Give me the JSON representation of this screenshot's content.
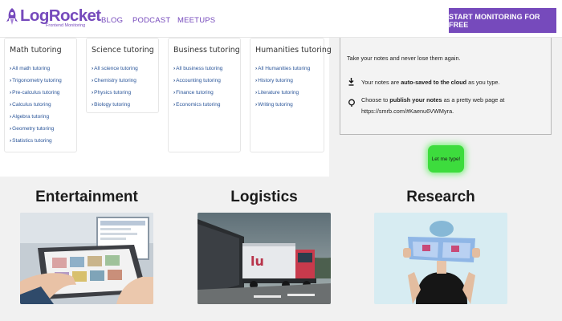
{
  "header": {
    "logo_text": "LogRocket",
    "logo_subtext": "Frontend Monitoring",
    "nav": [
      "BLOG",
      "PODCAST",
      "MEETUPS"
    ],
    "cta_label": "START MONITORING FOR FREE",
    "brand_color": "#764abc"
  },
  "tutoring": [
    {
      "title": "Math tutoring",
      "links": [
        "All math tutoring",
        "Trigonometry tutoring",
        "Pre-calculus tutoring",
        "Calculus tutoring",
        "Algebra tutoring",
        "Geometry tutoring",
        "Statistics tutoring"
      ]
    },
    {
      "title": "Science tutoring",
      "links": [
        "All science tutoring",
        "Chemistry tutoring",
        "Physics tutoring",
        "Biology tutoring"
      ]
    },
    {
      "title": "Business tutoring",
      "links": [
        "All business tutoring",
        "Accounting tutoring",
        "Finance tutoring",
        "Economics tutoring"
      ]
    },
    {
      "title": "Humanities tutoring",
      "links": [
        "All Humanities tutoring",
        "History tutoring",
        "Literature tutoring",
        "Writing tutoring"
      ]
    }
  ],
  "notes": {
    "intro": "Take your notes and never lose them again.",
    "line1_pre": "Your notes are ",
    "line1_bold": "auto-saved to the cloud",
    "line1_post": " as you type.",
    "line2_pre": "Choose to ",
    "line2_bold": "publish your notes",
    "line2_post": " as a pretty web page at",
    "line2_url": "https://smrb.com/#Kaenu6VWMyra."
  },
  "letme_button": "Let me type!",
  "industries": [
    {
      "title": "Entertainment",
      "image": "tablet-hands-photo"
    },
    {
      "title": "Logistics",
      "image": "truck-road-photo"
    },
    {
      "title": "Research",
      "image": "person-holding-paper-photo"
    }
  ]
}
